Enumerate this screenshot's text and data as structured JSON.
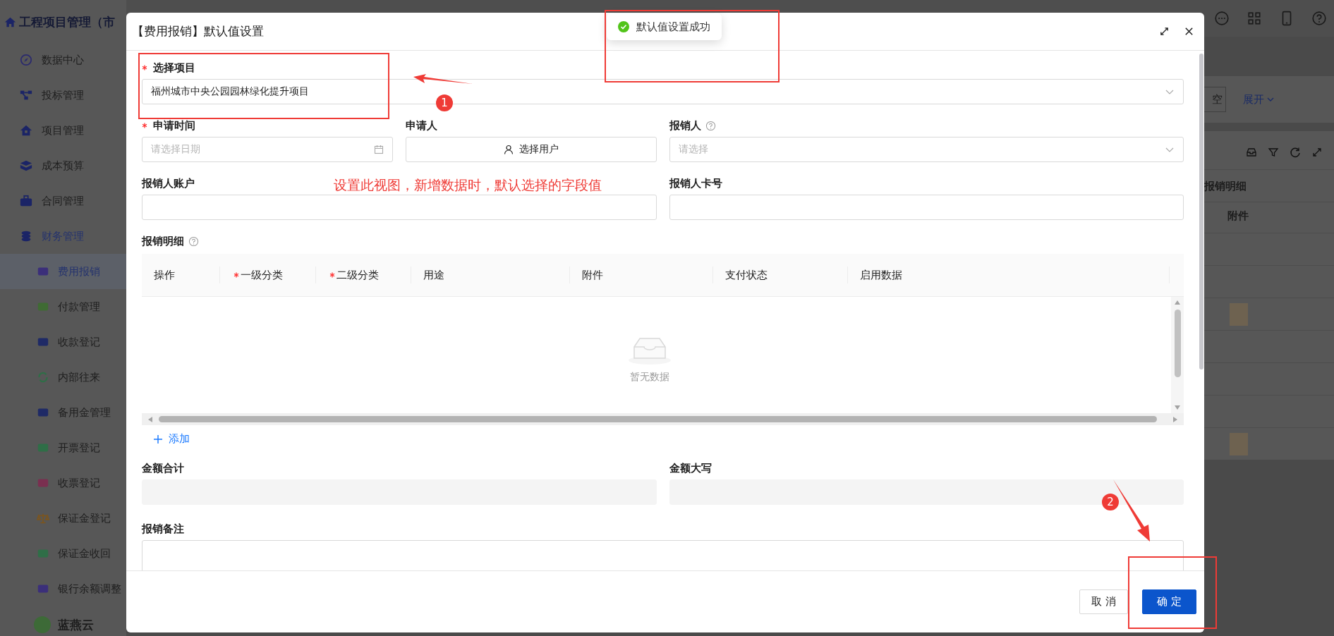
{
  "app": {
    "title": "工程项目管理（市",
    "sidebar": [
      {
        "label": "数据中心",
        "active": false
      },
      {
        "label": "投标管理",
        "active": false
      },
      {
        "label": "项目管理",
        "active": false
      },
      {
        "label": "成本预算",
        "active": false
      },
      {
        "label": "合同管理",
        "active": false
      },
      {
        "label": "财务管理",
        "active": true,
        "children": [
          {
            "label": "费用报销",
            "selected": true
          },
          {
            "label": "付款管理",
            "selected": false
          },
          {
            "label": "收款登记",
            "selected": false
          },
          {
            "label": "内部往来",
            "selected": false
          },
          {
            "label": "备用金管理",
            "selected": false
          },
          {
            "label": "开票登记",
            "selected": false
          },
          {
            "label": "收票登记",
            "selected": false
          },
          {
            "label": "保证金登记",
            "selected": false
          },
          {
            "label": "保证金收回",
            "selected": false
          },
          {
            "label": "银行余额调整",
            "selected": false
          }
        ]
      }
    ],
    "user": {
      "name": "蓝燕云"
    },
    "filter": {
      "reset_button": "空",
      "expand_link": "展开"
    },
    "table": {
      "group_header": "报销明细",
      "columns": [
        "附件"
      ]
    }
  },
  "dialog": {
    "title": "【费用报销】默认值设置",
    "fields_top": [
      [
        {
          "label": "选择项目",
          "required": true,
          "help": false,
          "kind": "select",
          "value": "福州城市中央公园园林绿化提升项目"
        }
      ],
      [
        {
          "label": "申请时间",
          "required": true,
          "help": false,
          "kind": "date",
          "placeholder": "请选择日期"
        },
        {
          "label": "申请人",
          "required": false,
          "help": false,
          "kind": "user",
          "value": "选择用户"
        },
        {
          "label": "报销人",
          "required": false,
          "help": true,
          "kind": "select",
          "placeholder": "请选择"
        }
      ],
      [
        {
          "label": "报销人账户",
          "required": false,
          "help": false,
          "kind": "input"
        },
        {
          "label": "报销人卡号",
          "required": false,
          "help": false,
          "kind": "input"
        }
      ]
    ],
    "detail": {
      "label": "报销明细",
      "help": true,
      "columns": [
        {
          "label": "操作",
          "required": false
        },
        {
          "label": "一级分类",
          "required": true
        },
        {
          "label": "二级分类",
          "required": true
        },
        {
          "label": "用途",
          "required": false
        },
        {
          "label": "附件",
          "required": false
        },
        {
          "label": "支付状态",
          "required": false
        },
        {
          "label": "启用数据",
          "required": false
        }
      ],
      "empty_text": "暂无数据",
      "add_button": "添加"
    },
    "fields_bottom": [
      [
        {
          "label": "金额合计",
          "required": false,
          "help": false,
          "kind": "readonly"
        },
        {
          "label": "金额大写",
          "required": false,
          "help": false,
          "kind": "readonly"
        }
      ],
      [
        {
          "label": "报销备注",
          "required": false,
          "help": false,
          "kind": "textarea"
        }
      ]
    ],
    "buttons": [
      {
        "label": "取 消",
        "kind": "default"
      },
      {
        "label": "确 定",
        "kind": "primary"
      }
    ]
  },
  "toast": {
    "text": "默认值设置成功"
  },
  "annotations": {
    "note": "设置此视图，新增数据时，默认选择的字段值",
    "markers": [
      "1",
      "2"
    ]
  }
}
